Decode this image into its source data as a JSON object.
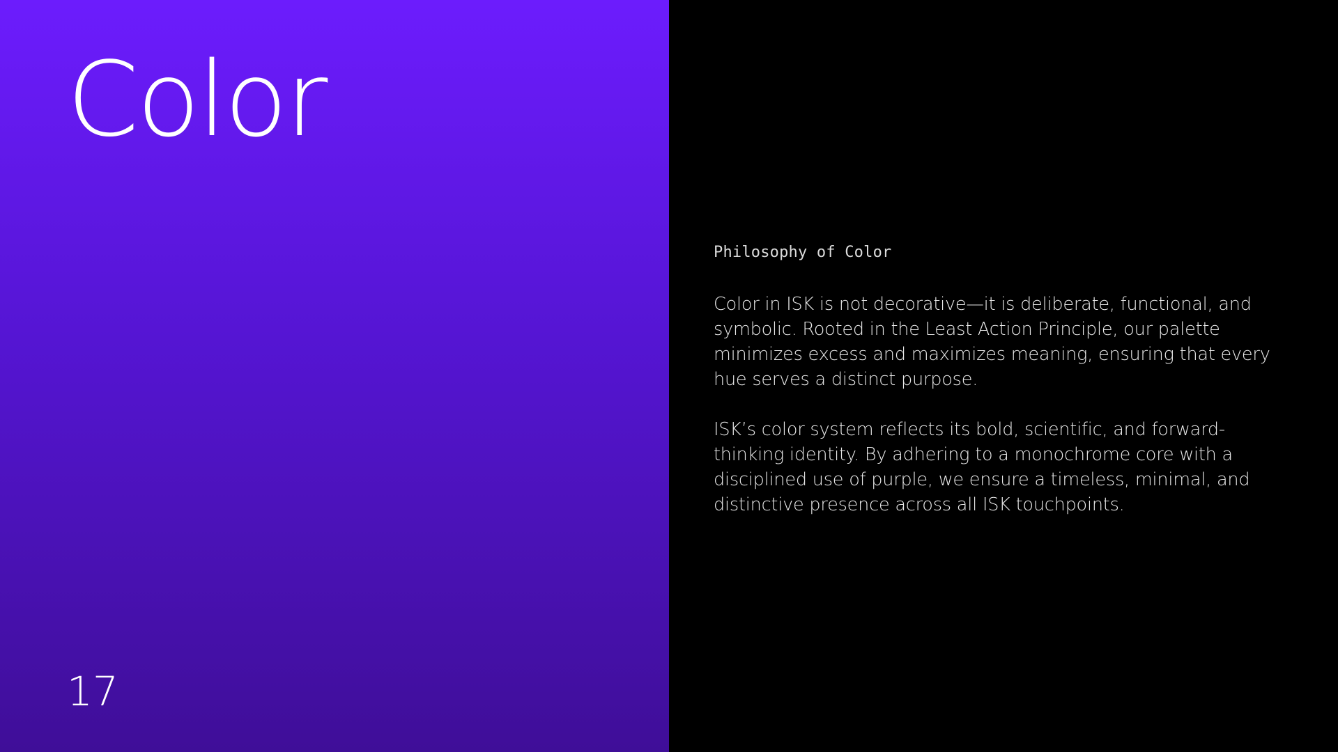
{
  "left_panel": {
    "title": "Color",
    "page_number": "17"
  },
  "right_panel": {
    "section_label": "Philosophy of Color",
    "paragraphs": [
      "Color in ISK is not decorative—it is deliberate, functional, and symbolic. Rooted in the Least Action Principle, our palette minimizes excess and maximizes meaning, ensuring that every hue serves a distinct purpose.",
      "ISK’s color system reflects its bold, scientific, and forward-thinking identity. By adhering to a monochrome core with a disciplined use of purple, we ensure a timeless, minimal, and distinctive presence across all ISK touchpoints."
    ]
  },
  "colors": {
    "gradient_top": "#6c1cfd",
    "gradient_bottom": "#3f0e98",
    "right_background": "#000000",
    "text": "#ffffff"
  }
}
